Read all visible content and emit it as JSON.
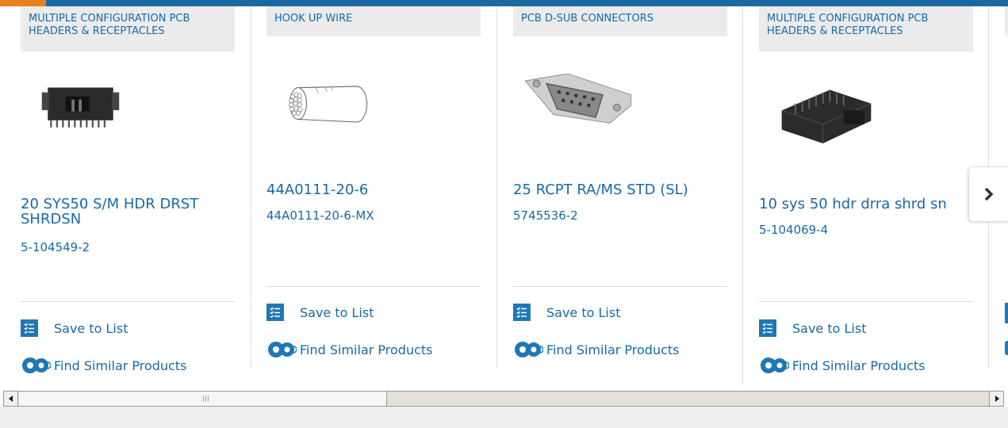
{
  "products": [
    {
      "category": "MULTIPLE CONFIGURATION PCB HEADERS & RECEPTACLES",
      "title": "20 SYS50 S/M HDR DRST SHRDSN",
      "part_number": "5-104549-2",
      "image": "black-pcb-header-connector"
    },
    {
      "category": "HOOK UP WIRE",
      "title": "44A0111-20-6",
      "part_number": "44A0111-20-6-MX",
      "image": "stranded-wire-drawing"
    },
    {
      "category": "PCB D-SUB CONNECTORS",
      "title": "25 RCPT RA/MS STD (SL)",
      "part_number": "5745536-2",
      "image": "d-sub-connector-photo"
    },
    {
      "category": "MULTIPLE CONFIGURATION PCB HEADERS & RECEPTACLES",
      "title": "10 sys 50 hdr drra shrd sn",
      "part_number": "5-104069-4",
      "image": "black-shrouded-header"
    }
  ],
  "actions": {
    "save_label": "Save to List",
    "similar_label": "Find Similar Products"
  },
  "icons": {
    "save": "checklist-icon",
    "similar": "gears-icon",
    "next": "chevron-right-icon",
    "scroll_left": "triangle-left-icon",
    "scroll_right": "triangle-right-icon"
  },
  "colors": {
    "link_blue": "#1769a8",
    "top_bar": "#1a6aa0",
    "top_accent": "#e8821e",
    "category_bg": "#ebebeb"
  }
}
